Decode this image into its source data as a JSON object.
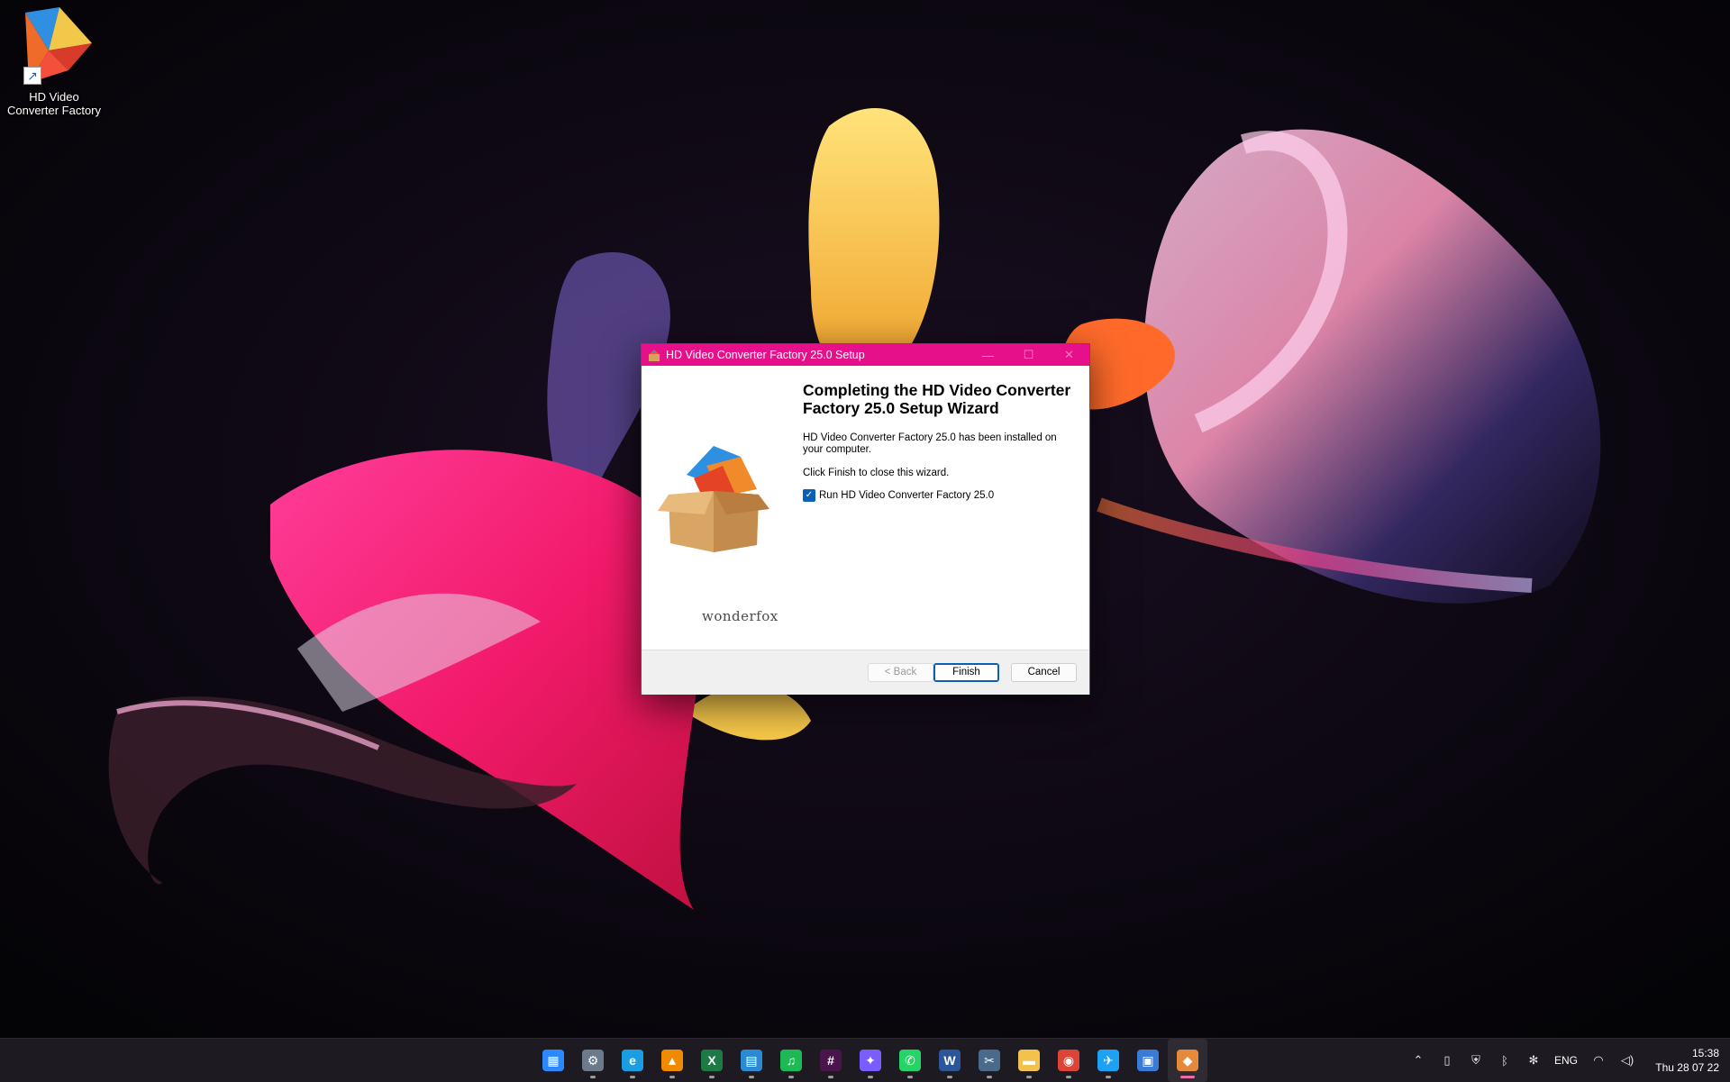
{
  "desktop": {
    "icons": [
      {
        "label": "HD Video Converter Factory"
      }
    ]
  },
  "dialog": {
    "title": "HD Video Converter Factory 25.0 Setup",
    "titlebar_buttons": {
      "minimize": "—",
      "maximize": "☐",
      "close": "✕"
    },
    "heading": "Completing the HD Video Converter Factory 25.0 Setup Wizard",
    "installed_text": "HD Video Converter Factory 25.0 has been installed on your computer.",
    "finish_text": "Click Finish to close this wizard.",
    "run_checkbox": {
      "label": "Run HD Video Converter Factory 25.0",
      "checked": true
    },
    "brand_text": "wonderfox",
    "buttons": {
      "back": "< Back",
      "finish": "Finish",
      "cancel": "Cancel"
    },
    "accent_color": "#e6118a"
  },
  "taskbar": {
    "apps": [
      {
        "name": "start-icon",
        "glyph": "▦",
        "color": "#2b88ff",
        "running": false
      },
      {
        "name": "settings-icon",
        "glyph": "⚙",
        "color": "#6b7b8c",
        "running": true
      },
      {
        "name": "edge-icon",
        "glyph": "e",
        "color": "#1b9de2",
        "running": true
      },
      {
        "name": "vlc-icon",
        "glyph": "▲",
        "color": "#f08a00",
        "running": true
      },
      {
        "name": "excel-icon",
        "glyph": "X",
        "color": "#1d7a45",
        "running": true
      },
      {
        "name": "company-portal-icon",
        "glyph": "▤",
        "color": "#2a8ad4",
        "running": true
      },
      {
        "name": "spotify-icon",
        "glyph": "♫",
        "color": "#1db954",
        "running": true
      },
      {
        "name": "slack-icon",
        "glyph": "#",
        "color": "#4a154b",
        "running": true
      },
      {
        "name": "messenger-icon",
        "glyph": "✦",
        "color": "#7a5cff",
        "running": true
      },
      {
        "name": "whatsapp-icon",
        "glyph": "✆",
        "color": "#25d366",
        "running": true
      },
      {
        "name": "word-icon",
        "glyph": "W",
        "color": "#2b579a",
        "running": true
      },
      {
        "name": "snipping-tool-icon",
        "glyph": "✂",
        "color": "#4a6a8c",
        "running": true
      },
      {
        "name": "file-explorer-icon",
        "glyph": "▬",
        "color": "#f2c14e",
        "running": true
      },
      {
        "name": "chrome-icon",
        "glyph": "◉",
        "color": "#db4437",
        "running": true
      },
      {
        "name": "twitter-icon",
        "glyph": "✈",
        "color": "#1da1f2",
        "running": true
      },
      {
        "name": "store-icon",
        "glyph": "▣",
        "color": "#3a7bd5",
        "running": false
      },
      {
        "name": "installer-icon",
        "glyph": "◆",
        "color": "#e48a3a",
        "running": true,
        "active": true
      }
    ],
    "tray": {
      "chevron": "⌃",
      "language": "ENG",
      "time": "15:38",
      "date": "Thu 28 07 22"
    }
  }
}
